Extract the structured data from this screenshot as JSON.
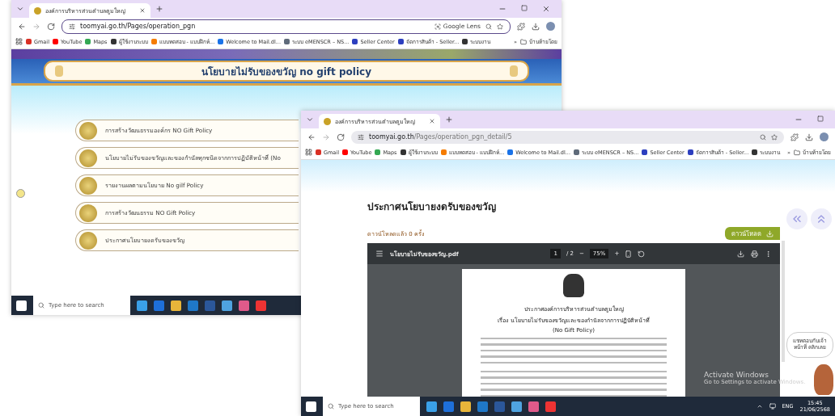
{
  "back_window": {
    "tab_title": "องค์การบริหารส่วนตำบลตูมใหญ่",
    "url": "toomyai.go.th/Pages/operation_pgn",
    "lens_label": "Google Lens",
    "bookmarks": [
      {
        "label": "Gmail",
        "color": "#d93025"
      },
      {
        "label": "YouTube",
        "color": "#ff0000"
      },
      {
        "label": "Maps",
        "color": "#34a853"
      },
      {
        "label": "ผู้ใช้งานระบบ",
        "color": "#333333"
      },
      {
        "label": "แบบทดสอบ - แบบฝึกห์...",
        "color": "#f57c00"
      },
      {
        "label": "Welcome to Mail.dl...",
        "color": "#1a73e8"
      },
      {
        "label": "ระบบ eMENSCR – NS...",
        "color": "#5f6b7a"
      },
      {
        "label": "Seller Center",
        "color": "#2d3fbf"
      },
      {
        "label": "จัดการสินค้า - Seller...",
        "color": "#2d3fbf"
      },
      {
        "label": "ระบบงาน",
        "color": "#333333"
      }
    ],
    "more_bookmarks": "»",
    "all_bookmarks": "บ้านท้ายโดย",
    "banner_title": "นโยบายไม่รับของขวัญ no gift policy",
    "items": [
      "การสร้างวัฒนธรรมองค์กร NO Gift Policy",
      "นโยบายไม่รับของขวัญและของกำนัลทุกชนิดจากการปฏิบัติหน้าที่ (No",
      "รายงานผลตามนโยบาย No gilf Policy",
      "การสร้างวัฒนธรรม NO Gift Policy",
      "ประกาศนโยบายงดรับของขวัญ"
    ],
    "taskbar_search": "Type here to search"
  },
  "front_window": {
    "tab_title": "องค์การบริหารส่วนตำบลตูมใหญ่",
    "url_host": "toomyai.go.th",
    "url_path": "/Pages/operation_pgn_detail/5",
    "bookmarks": [
      {
        "label": "Gmail",
        "color": "#d93025"
      },
      {
        "label": "YouTube",
        "color": "#ff0000"
      },
      {
        "label": "Maps",
        "color": "#34a853"
      },
      {
        "label": "ผู้ใช้งานระบบ",
        "color": "#333333"
      },
      {
        "label": "แบบทดสอบ - แบบฝึกห์...",
        "color": "#f57c00"
      },
      {
        "label": "Welcome to Mail.dl...",
        "color": "#1a73e8"
      },
      {
        "label": "ระบบ eMENSCR – NS...",
        "color": "#5f6b7a"
      },
      {
        "label": "Seller Center",
        "color": "#2d3fbf"
      },
      {
        "label": "จัดการสินค้า - Seller...",
        "color": "#2d3fbf"
      },
      {
        "label": "ระบบงาน",
        "color": "#333333"
      }
    ],
    "more_bookmarks": "»",
    "all_bookmarks": "บ้านท้ายโดย",
    "heading": "ประกาศนโยบายงดรับของขวัญ",
    "download_count": "ดาวน์โหลดแล้ว 0 ครั้ง",
    "download_button": "ดาวน์โหลด",
    "pdf": {
      "file_name": "นโยบายไม่รับของขวัญ.pdf",
      "page": "1",
      "page_total": "/ 2",
      "zoom": "75%",
      "zoom_out": "−",
      "zoom_in": "+",
      "doc_lines": [
        "ประกาศองค์การบริหารส่วนตำบลตูมใหญ่",
        "เรื่อง นโยบายไม่รับของขวัญและของกำนัลจากการปฏิบัติหน้าที่",
        "(No Gift Policy)"
      ]
    },
    "chat_bubble": "แชทตอบกับเจ้าหน้าที่ คลิกเลย",
    "activation_title": "Activate Windows",
    "activation_hint": "Go to Settings to activate Windows.",
    "taskbar_search": "Type here to search",
    "tray": {
      "language": "ENG",
      "time": "15:45",
      "date": "21/06/2568"
    }
  }
}
